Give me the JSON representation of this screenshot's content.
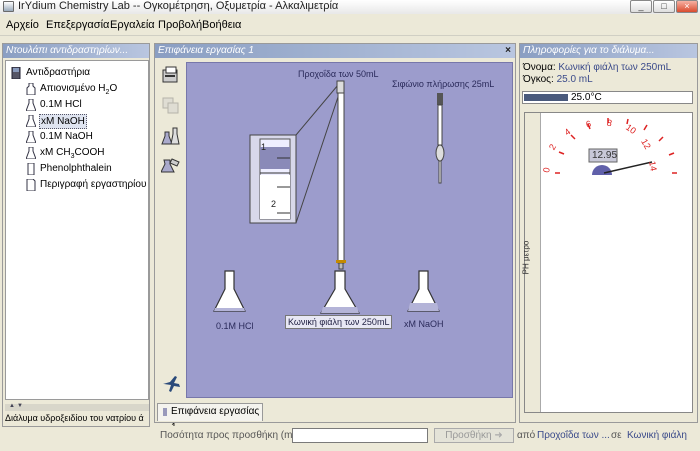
{
  "window": {
    "title": "IrYdium Chemistry Lab -- Ογκομέτρηση, Οξυμετρία - Αλκαλιμετρία",
    "min": "_",
    "max": "□",
    "close": "×"
  },
  "menu": [
    "Αρχείο",
    "Επεξεργασία",
    "Εργαλεία",
    "Προβολή",
    "Βοήθεια"
  ],
  "stockroom": {
    "header": "Ντουλάπι αντιδραστηρίων...",
    "root": "Αντιδραστήρια",
    "items": [
      {
        "label_main": "Απιονισμένο H",
        "label_sub": "2",
        "label_tail": "O"
      },
      {
        "label_main": "0.1M HCl"
      },
      {
        "label_main": "xM NaOH",
        "selected": true
      },
      {
        "label_main": "0.1M NaOH"
      },
      {
        "label_main": "xM CH",
        "label_sub": "3",
        "label_tail": "COOH"
      },
      {
        "label_main": "Phenolphthalein"
      },
      {
        "label_main": "Περιγραφή εργαστηρίου"
      }
    ],
    "scroll_up": "▲",
    "scroll_down": "▼",
    "status": "Διάλυμα υδροξειδίου του νατρίου ά"
  },
  "workbench": {
    "header": "Επιφάνεια εργασίας 1",
    "close": "×",
    "burette_label": "Προχοΐδα των 50mL",
    "pipette_label": "Σιφώνιο πλήρωσης 25mL",
    "zoom_marks": [
      "1",
      "2"
    ],
    "flask_left_label": "0.1M HCl",
    "flask_center_label": "Κωνική φιάλη των 250mL",
    "flask_right_label": "xM NaOH",
    "tab_label": "Επιφάνεια εργασίας 1"
  },
  "info": {
    "header": "Πληροφορίες για το διάλυμα...",
    "name_key": "Όνομα:",
    "name_value": "Κωνική φιάλη των 250mL",
    "volume_key": "Όγκος:",
    "volume_value": "25.0 mL",
    "temperature": "25.0°C",
    "temperature_fraction": 0.3,
    "ph_meter_label": "PH μετρο",
    "ph_value": "12.95",
    "ph_scale": [
      "0",
      "2",
      "4",
      "6",
      "8",
      "10",
      "12",
      "14"
    ]
  },
  "bottom": {
    "qty_label": "Ποσότητα προς προσθήκη (mL):",
    "qty_value": "",
    "add_button": "Προσθήκη",
    "from_label": "από",
    "from_value": "Προχοΐδα των ...",
    "to_label": "σε",
    "to_value": "Κωνική φιάλη"
  },
  "colors": {
    "bench": "#9c9ccc",
    "header": "#8a9ec2",
    "link": "#3a4a8a"
  }
}
